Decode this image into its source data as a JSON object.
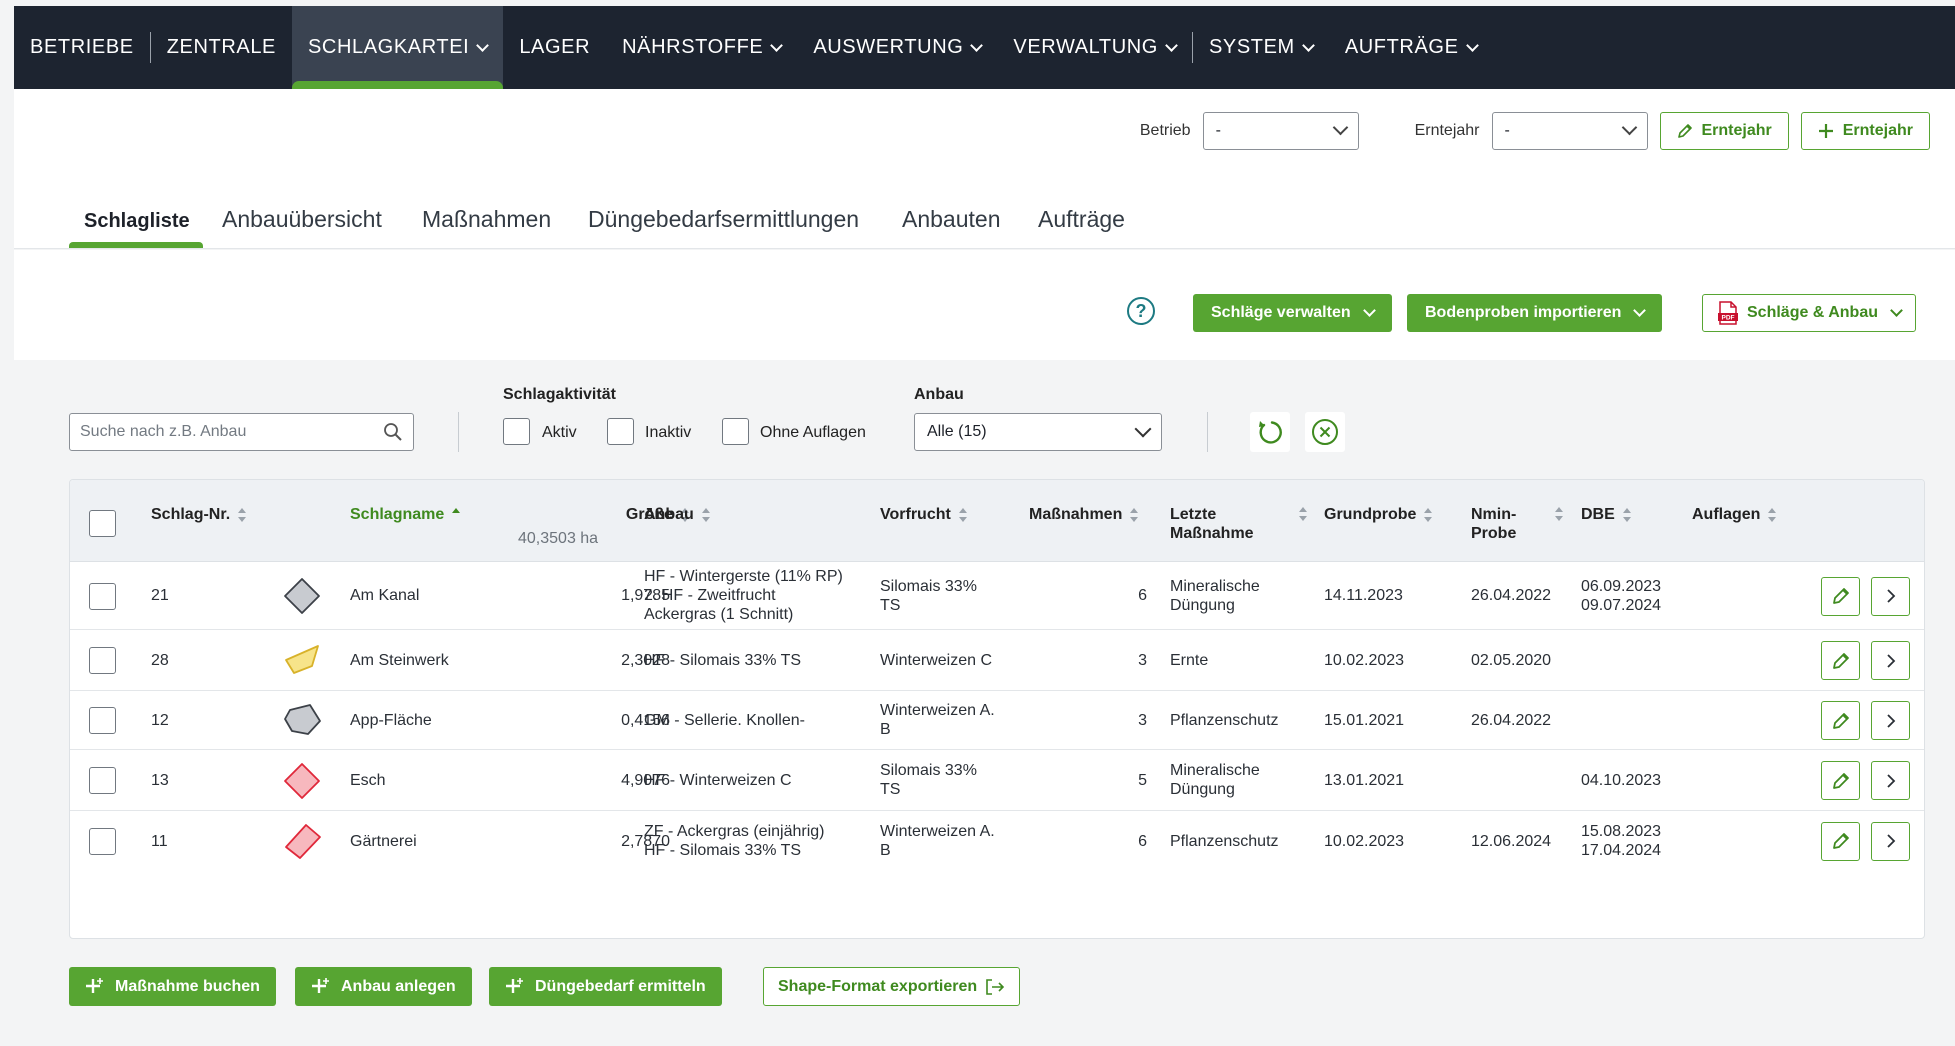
{
  "nav": {
    "items": [
      {
        "label": "BETRIEBE",
        "dropdown": false
      },
      {
        "label": "ZENTRALE",
        "dropdown": false
      },
      {
        "label": "SCHLAGKARTEI",
        "dropdown": true,
        "active": true
      },
      {
        "label": "LAGER",
        "dropdown": false
      },
      {
        "label": "NÄHRSTOFFE",
        "dropdown": true
      },
      {
        "label": "AUSWERTUNG",
        "dropdown": true
      },
      {
        "label": "VERWALTUNG",
        "dropdown": true
      },
      {
        "label": "SYSTEM",
        "dropdown": true
      },
      {
        "label": "AUFTRÄGE",
        "dropdown": true
      }
    ]
  },
  "subbar": {
    "betrieb_label": "Betrieb",
    "betrieb_value": "-",
    "erntejahr_label": "Erntejahr",
    "erntejahr_value": "-",
    "edit_erntejahr_label": "Erntejahr",
    "add_erntejahr_label": "Erntejahr"
  },
  "tabs": {
    "items": [
      "Schlagliste",
      "Anbauübersicht",
      "Maßnahmen",
      "Düngebedarfsermittlungen",
      "Anbauten",
      "Aufträge"
    ],
    "active": "Schlagliste"
  },
  "actions": {
    "help_glyph": "?",
    "schlaege_verwalten": "Schläge verwalten",
    "bodenproben_importieren": "Bodenproben importieren",
    "pdf_badge": "PDF",
    "schlaege_anbau": "Schläge & Anbau"
  },
  "filters": {
    "search_placeholder": "Suche nach z.B. Anbau",
    "schlagaktivitaet_label": "Schlagaktivität",
    "aktiv_label": "Aktiv",
    "inaktiv_label": "Inaktiv",
    "ohne_auflagen_label": "Ohne Auflagen",
    "anbau_label": "Anbau",
    "anbau_value": "Alle (15)"
  },
  "table": {
    "headers": {
      "schlag_nr": "Schlag-Nr.",
      "schlagname": "Schlagname",
      "groesse": "Größe",
      "groesse_total": "40,3503 ha",
      "anbau": "Anbau",
      "vorfrucht": "Vorfrucht",
      "massnahmen": "Maßnahmen",
      "letzte_massnahme": "Letzte\nMaßnahme",
      "grundprobe": "Grundprobe",
      "nmin_probe": "Nmin-\nProbe",
      "dbe": "DBE",
      "auflagen": "Auflagen"
    },
    "rows": [
      {
        "nr": "21",
        "name": "Am Kanal",
        "groesse": "1,9785",
        "anbau": "HF - Wintergerste (11% RP)\n2. HF - Zweitfrucht\nAckergras (1 Schnitt)",
        "vorfrucht": "Silomais 33%\nTS",
        "massnahmen": "6",
        "letzte": "Mineralische\nDüngung",
        "grundprobe": "14.11.2023",
        "nmin": "26.04.2022",
        "dbe": "06.09.2023\n09.07.2024",
        "auflagen": "",
        "shape": "diamond",
        "fill": "#c8cbd0",
        "stroke": "#3c4148"
      },
      {
        "nr": "28",
        "name": "Am Steinwerk",
        "groesse": "2,3028",
        "anbau": "HF - Silomais 33% TS",
        "vorfrucht": "Winterweizen C",
        "massnahmen": "3",
        "letzte": "Ernte",
        "grundprobe": "10.02.2023",
        "nmin": "02.05.2020",
        "dbe": "",
        "auflagen": "",
        "shape": "parallelogram",
        "fill": "#f7e48a",
        "stroke": "#d8b22a"
      },
      {
        "nr": "12",
        "name": "App-Fläche",
        "groesse": "0,4156",
        "anbau": "GM - Sellerie. Knollen-",
        "vorfrucht": "Winterweizen A.\nB",
        "massnahmen": "3",
        "letzte": "Pflanzenschutz",
        "grundprobe": "15.01.2021",
        "nmin": "26.04.2022",
        "dbe": "",
        "auflagen": "",
        "shape": "pentagon",
        "fill": "#c8cbd0",
        "stroke": "#3c4148"
      },
      {
        "nr": "13",
        "name": "Esch",
        "groesse": "4,9076",
        "anbau": "HF - Winterweizen C",
        "vorfrucht": "Silomais 33%\nTS",
        "massnahmen": "5",
        "letzte": "Mineralische\nDüngung",
        "grundprobe": "13.01.2021",
        "nmin": "",
        "dbe": "04.10.2023",
        "auflagen": "",
        "shape": "diamond",
        "fill": "#f7b8be",
        "stroke": "#e0283a"
      },
      {
        "nr": "11",
        "name": "Gärtnerei",
        "groesse": "2,7870",
        "anbau": "ZF - Ackergras (einjährig)\nHF - Silomais 33% TS",
        "vorfrucht": "Winterweizen A.\nB",
        "massnahmen": "6",
        "letzte": "Pflanzenschutz",
        "grundprobe": "10.02.2023",
        "nmin": "12.06.2024",
        "dbe": "15.08.2023\n17.04.2024",
        "auflagen": "",
        "shape": "slanted",
        "fill": "#f7b8be",
        "stroke": "#e0283a"
      }
    ]
  },
  "bottom": {
    "massnahme_buchen": "Maßnahme buchen",
    "anbau_anlegen": "Anbau anlegen",
    "duengebedarf_ermitteln": "Düngebedarf ermitteln",
    "shape_export": "Shape-Format exportieren"
  },
  "colors": {
    "brand_green": "#57a532",
    "nav_bg": "#1d2430",
    "help_teal": "#1d7a82"
  }
}
